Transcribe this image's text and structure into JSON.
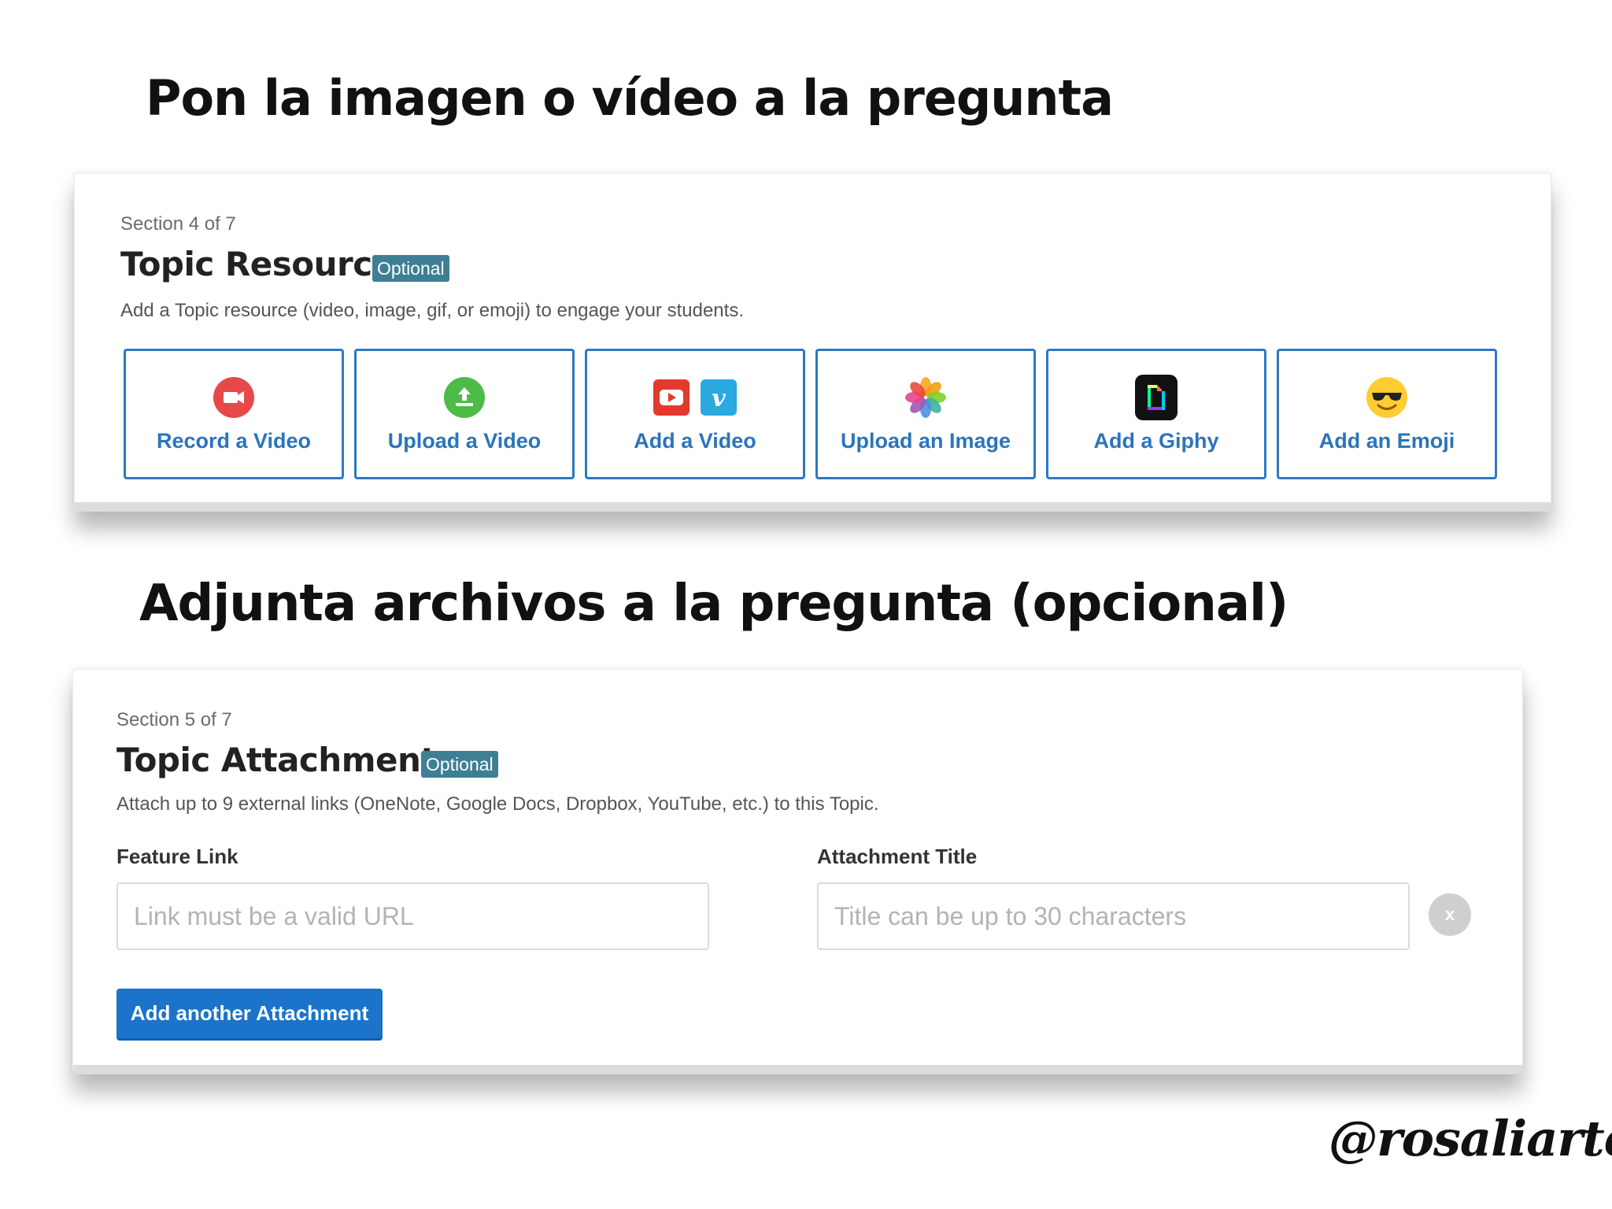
{
  "headings": {
    "first": "Pon la imagen o vídeo a la pregunta",
    "second": "Adjunta archivos a la pregunta (opcional)"
  },
  "resource_section": {
    "count": "Section 4 of 7",
    "title": "Topic Resource",
    "badge": "Optional",
    "description": "Add a Topic resource (video, image, gif, or emoji) to engage your students.",
    "buttons": [
      {
        "label": "Record a Video",
        "icon": "record-video-icon"
      },
      {
        "label": "Upload a Video",
        "icon": "upload-video-icon"
      },
      {
        "label": "Add a Video",
        "icon": "youtube-vimeo-icons"
      },
      {
        "label": "Upload an Image",
        "icon": "photos-icon"
      },
      {
        "label": "Add a Giphy",
        "icon": "giphy-icon"
      },
      {
        "label": "Add an Emoji",
        "icon": "sunglasses-emoji-icon"
      }
    ]
  },
  "attachments_section": {
    "count": "Section 5 of 7",
    "title": "Topic Attachments",
    "badge": "Optional",
    "description": "Attach up to 9 external links (OneNote, Google Docs, Dropbox, YouTube, etc.) to this Topic.",
    "feature_link_label": "Feature Link",
    "feature_link_placeholder": "Link must be a valid URL",
    "attachment_title_label": "Attachment Title",
    "attachment_title_placeholder": "Title can be up to 30 characters",
    "remove_label": "x",
    "add_button_label": "Add another Attachment"
  },
  "watermark": "@rosaliarte",
  "colors": {
    "accent_blue": "#2d79c2",
    "badge_teal": "#3e7f95",
    "primary_button": "#1b74c9"
  }
}
